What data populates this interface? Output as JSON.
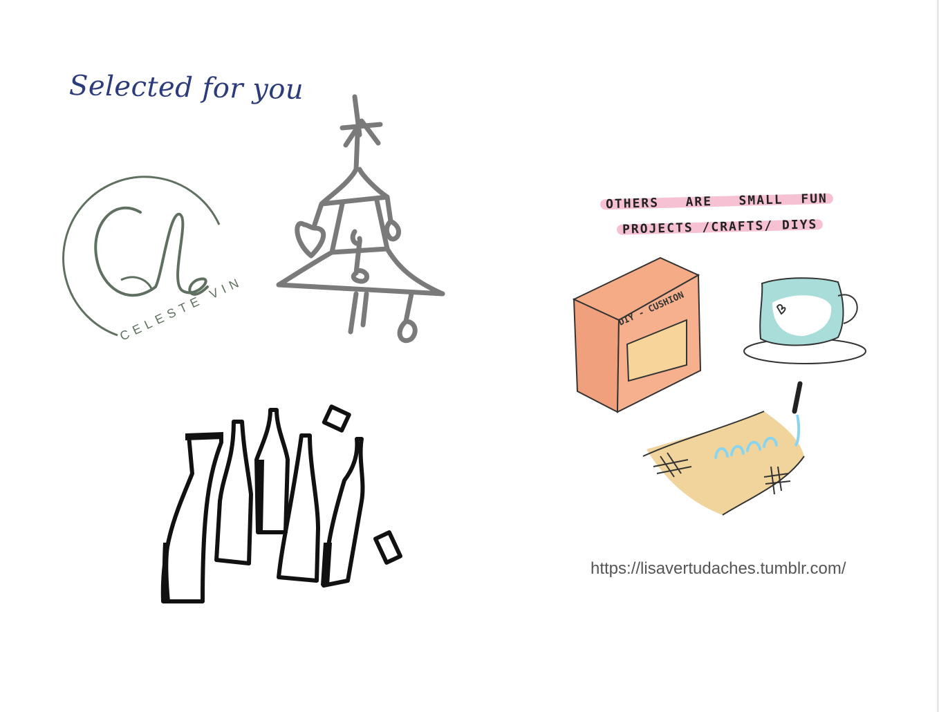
{
  "heading": "Selected for you",
  "logo": {
    "monogram": "CeV",
    "text": "CELESTE VIN",
    "color": "#5f7060"
  },
  "caption": {
    "line1": "OTHERS   ARE   SMALL  FUN",
    "line2": "PROJECTS /CRAFTS/ DIYS",
    "highlight_color": "#f6c2d3"
  },
  "box_label": "DIY - CUSHION",
  "url": "https://lisavertudaches.tumblr.com/"
}
